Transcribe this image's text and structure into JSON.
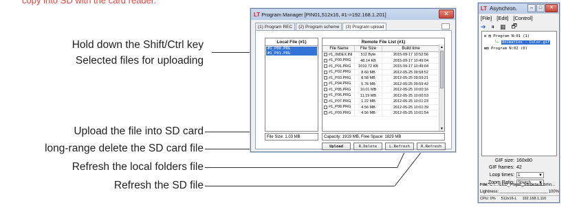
{
  "top_note": "copy into SD with the card reader.",
  "callouts": {
    "shift_ctrl_line1": "Hold down the Shift/Ctrl key",
    "shift_ctrl_line2": "Selected files for uploading",
    "upload": "Upload the file into SD card",
    "delete": "long-range delete the SD card file",
    "refresh_local": "Refresh the local folders file",
    "refresh_sd": "Refresh the SD file"
  },
  "program_manager": {
    "logo": "LT",
    "title": "Program Manager  [PIN01,512x16, #1->192.168.1.201]",
    "close": "✕",
    "tabs": [
      "(1) Program REC",
      "(2) Program scheme",
      "(3) Program upload"
    ],
    "local": {
      "title": "Local File (#1)",
      "items": [
        "#1_P00.PRG",
        "#1_P01.PRG"
      ],
      "file_size": "File Size: 1.03 MB"
    },
    "remote": {
      "title": "Remote File List (#1)",
      "columns": [
        "File Name",
        "File Size",
        "Build time"
      ],
      "rows": [
        [
          "#1_INDEX.INI",
          "512 Byte",
          "2015-09-17 10:52:56"
        ],
        [
          "#1_P00.PRG",
          "48.14 KB",
          "2015-09-17 10:49:04"
        ],
        [
          "#1_P01.PRG",
          "1010.72 KB",
          "2015-09-17 10:49:04"
        ],
        [
          "#1_P02.PRG",
          "8.60 MB",
          "2012-05-25 09:58:52"
        ],
        [
          "#1_P03.PRG",
          "8.58 MB",
          "2012-05-25 09:59:21"
        ],
        [
          "#1_P04.PRG",
          "5.76 MB",
          "2012-05-25 09:59:42"
        ],
        [
          "#1_P05.PRG",
          "10.01 MB",
          "2012-05-25 10:00:16"
        ],
        [
          "#1_P06.PRG",
          "11.19 MB",
          "2012-05-25 10:00:53"
        ],
        [
          "#1_P07.PRG",
          "1.22 MB",
          "2012-05-25 10:01:23"
        ],
        [
          "#1_P08.PRG",
          "4.56 MB",
          "2012-05-25 10:01:39"
        ],
        [
          "#1_P09.PRG",
          "4.56 MB",
          "2012-05-25 10:01:54"
        ]
      ],
      "capacity": "Capacity: 1919 MB,  Free Space: 1829 MB"
    },
    "buttons": {
      "upload": "Upload",
      "delete": "R.Delete",
      "l_refresh": "L.Refresh",
      "r_refresh": "R.Refresh"
    }
  },
  "asynchron": {
    "logo": "LT",
    "title": "Asynchron.",
    "window_buttons": [
      "–",
      "□",
      "✕"
    ],
    "menu": [
      "[File]",
      "[Edit]",
      "[Control]"
    ],
    "toolbar": [
      "➔",
      "⏸",
      "▦",
      "🗗"
    ],
    "tree": {
      "prog1": "Program N:01 (1)",
      "prog1_child": "Animation - Color.gif",
      "prog2": "Program N:02 (0)"
    },
    "fields": {
      "gif_size_label": "GIF size:",
      "gif_size_value": "160x80",
      "gif_frames_label": "GIF frames:",
      "gif_frames_value": "42",
      "loop_label": "Loop times:",
      "loop_value": "1",
      "zoom_label": "Zoom Ratio:",
      "zoom_value": "Stretch"
    },
    "file_label": "File:",
    "file_path": "C:\\...\\LED_Player_V6\\default.bmn...",
    "lightness_label": "Lightness:",
    "lightness_value": "100%",
    "status": {
      "cpu": "CPU: 0%",
      "mode": "512x16-L",
      "ip": "192.168.1.110"
    }
  }
}
